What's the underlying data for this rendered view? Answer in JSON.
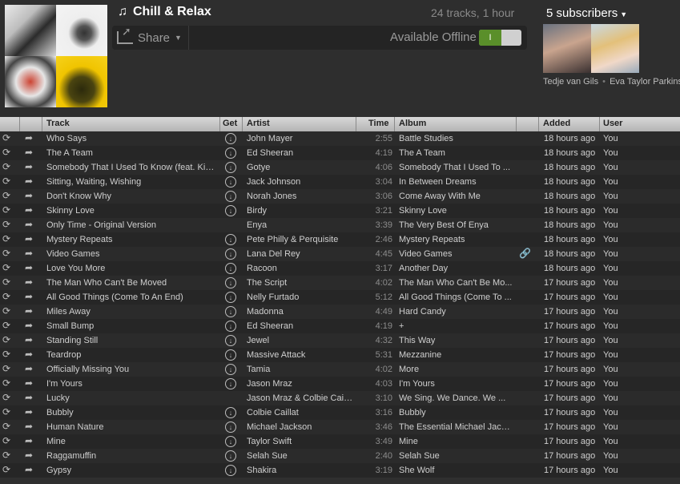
{
  "playlist": {
    "title": "Chill & Relax",
    "meta": "24 tracks, 1 hour",
    "share_label": "Share",
    "offline_label": "Available Offline",
    "toggle_on": "I"
  },
  "subscribers": {
    "label": "5 subscribers",
    "name1": "Tedje van Gils",
    "sep": "•",
    "name2": "Eva Taylor Parkins"
  },
  "columns": {
    "track": "Track",
    "get": "Get",
    "artist": "Artist",
    "time": "Time",
    "album": "Album",
    "added": "Added",
    "user": "User"
  },
  "tracks": [
    {
      "track": "Who Says",
      "artist": "John Mayer",
      "time": "2:55",
      "album": "Battle Studies",
      "added": "18 hours ago",
      "user": "You",
      "get": true
    },
    {
      "track": "The A Team",
      "artist": "Ed Sheeran",
      "time": "4:19",
      "album": "The A Team",
      "added": "18 hours ago",
      "user": "You",
      "get": true
    },
    {
      "track": "Somebody That I Used To Know (feat. Kim...",
      "artist": "Gotye",
      "time": "4:06",
      "album": "Somebody That I Used To ...",
      "added": "18 hours ago",
      "user": "You",
      "get": true
    },
    {
      "track": "Sitting, Waiting, Wishing",
      "artist": "Jack Johnson",
      "time": "3:04",
      "album": "In Between Dreams",
      "added": "18 hours ago",
      "user": "You",
      "get": true
    },
    {
      "track": "Don't Know Why",
      "artist": "Norah Jones",
      "time": "3:06",
      "album": "Come Away With Me",
      "added": "18 hours ago",
      "user": "You",
      "get": true
    },
    {
      "track": "Skinny Love",
      "artist": "Birdy",
      "time": "3:21",
      "album": "Skinny Love",
      "added": "18 hours ago",
      "user": "You",
      "get": true
    },
    {
      "track": "Only Time - Original Version",
      "artist": "Enya",
      "time": "3:39",
      "album": "The Very Best Of Enya",
      "added": "18 hours ago",
      "user": "You",
      "get": false
    },
    {
      "track": "Mystery Repeats",
      "artist": "Pete Philly & Perquisite",
      "time": "2:46",
      "album": "Mystery Repeats",
      "added": "18 hours ago",
      "user": "You",
      "get": true
    },
    {
      "track": "Video Games",
      "artist": "Lana Del Rey",
      "time": "4:45",
      "album": "Video Games",
      "added": "18 hours ago",
      "user": "You",
      "get": true,
      "link": true
    },
    {
      "track": "Love You More",
      "artist": "Racoon",
      "time": "3:17",
      "album": "Another Day",
      "added": "18 hours ago",
      "user": "You",
      "get": true
    },
    {
      "track": "The Man Who Can't Be Moved",
      "artist": "The Script",
      "time": "4:02",
      "album": "The Man Who Can't Be Mo...",
      "added": "17 hours ago",
      "user": "You",
      "get": true
    },
    {
      "track": "All Good Things (Come To An End)",
      "artist": "Nelly Furtado",
      "time": "5:12",
      "album": "All Good Things (Come To ...",
      "added": "17 hours ago",
      "user": "You",
      "get": true
    },
    {
      "track": "Miles Away",
      "artist": "Madonna",
      "time": "4:49",
      "album": "Hard Candy",
      "added": "17 hours ago",
      "user": "You",
      "get": true
    },
    {
      "track": "Small Bump",
      "artist": "Ed Sheeran",
      "time": "4:19",
      "album": "+",
      "added": "17 hours ago",
      "user": "You",
      "get": true
    },
    {
      "track": "Standing Still",
      "artist": "Jewel",
      "time": "4:32",
      "album": "This Way",
      "added": "17 hours ago",
      "user": "You",
      "get": true
    },
    {
      "track": "Teardrop",
      "artist": "Massive Attack",
      "time": "5:31",
      "album": "Mezzanine",
      "added": "17 hours ago",
      "user": "You",
      "get": true
    },
    {
      "track": "Officially Missing You",
      "artist": "Tamia",
      "time": "4:02",
      "album": "More",
      "added": "17 hours ago",
      "user": "You",
      "get": true
    },
    {
      "track": "I'm Yours",
      "artist": "Jason Mraz",
      "time": "4:03",
      "album": "I'm Yours",
      "added": "17 hours ago",
      "user": "You",
      "get": true
    },
    {
      "track": "Lucky",
      "artist": "Jason Mraz & Colbie Caillat",
      "time": "3:10",
      "album": "We Sing. We Dance. We ...",
      "added": "17 hours ago",
      "user": "You",
      "get": false
    },
    {
      "track": "Bubbly",
      "artist": "Colbie Caillat",
      "time": "3:16",
      "album": "Bubbly",
      "added": "17 hours ago",
      "user": "You",
      "get": true
    },
    {
      "track": "Human Nature",
      "artist": "Michael Jackson",
      "time": "3:46",
      "album": "The Essential Michael Jackson",
      "added": "17 hours ago",
      "user": "You",
      "get": true
    },
    {
      "track": "Mine",
      "artist": "Taylor Swift",
      "time": "3:49",
      "album": "Mine",
      "added": "17 hours ago",
      "user": "You",
      "get": true
    },
    {
      "track": "Raggamuffin",
      "artist": "Selah Sue",
      "time": "2:40",
      "album": "Selah Sue",
      "added": "17 hours ago",
      "user": "You",
      "get": true
    },
    {
      "track": "Gypsy",
      "artist": "Shakira",
      "time": "3:19",
      "album": "She Wolf",
      "added": "17 hours ago",
      "user": "You",
      "get": true
    }
  ]
}
